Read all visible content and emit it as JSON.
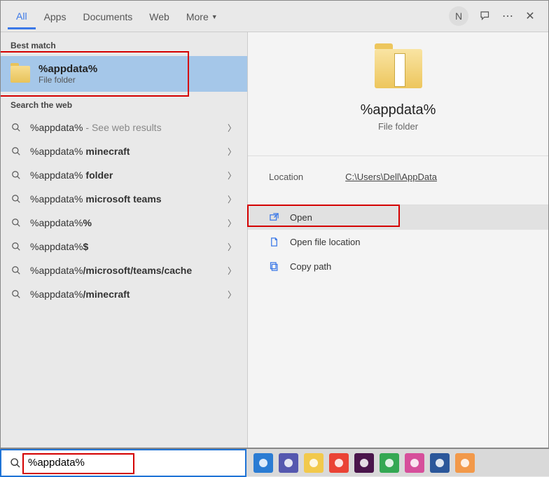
{
  "tabs": {
    "all": "All",
    "apps": "Apps",
    "documents": "Documents",
    "web": "Web",
    "more": "More"
  },
  "avatar_letter": "N",
  "sections": {
    "best_match": "Best match",
    "search_web": "Search the web"
  },
  "best_match": {
    "title": "%appdata%",
    "subtitle": "File folder"
  },
  "web_results": [
    {
      "prefix": "%appdata%",
      "suffix": "",
      "hint": " - See web results"
    },
    {
      "prefix": "%appdata%",
      "suffix": " minecraft",
      "hint": ""
    },
    {
      "prefix": "%appdata%",
      "suffix": " folder",
      "hint": ""
    },
    {
      "prefix": "%appdata%",
      "suffix": " microsoft teams",
      "hint": ""
    },
    {
      "prefix": "%appdata%",
      "suffix": "%",
      "hint": ""
    },
    {
      "prefix": "%appdata%",
      "suffix": "$",
      "hint": ""
    },
    {
      "prefix": "%appdata%",
      "suffix": "/microsoft/teams/cache",
      "hint": ""
    },
    {
      "prefix": "%appdata%",
      "suffix": "/minecraft",
      "hint": ""
    }
  ],
  "details": {
    "title": "%appdata%",
    "subtitle": "File folder",
    "location_label": "Location",
    "location_value": "C:\\Users\\Dell\\AppData",
    "actions": {
      "open": "Open",
      "open_location": "Open file location",
      "copy_path": "Copy path"
    }
  },
  "search_value": "%appdata%",
  "taskbar_apps": [
    "edge",
    "teams",
    "explorer",
    "chrome",
    "slack",
    "chrome2",
    "snip",
    "word",
    "paint"
  ]
}
